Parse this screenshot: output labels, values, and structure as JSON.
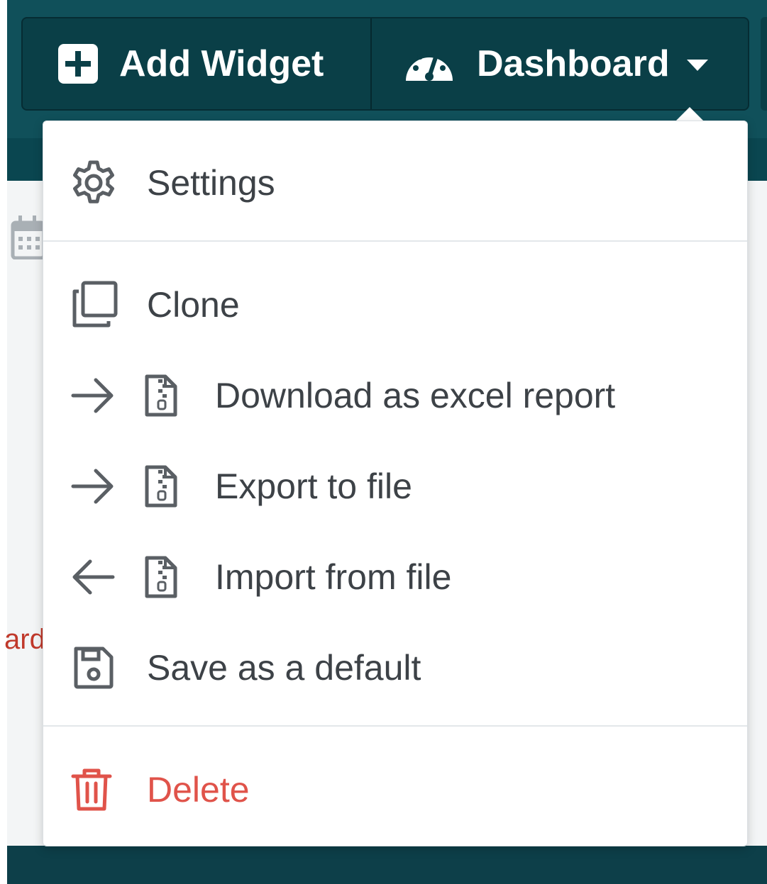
{
  "toolbar": {
    "add_widget_label": "Add Widget",
    "dashboard_label": "Dashboard"
  },
  "background": {
    "peek_text": "ard"
  },
  "menu": {
    "settings": "Settings",
    "clone": "Clone",
    "download_excel": "Download as excel report",
    "export_file": "Export to file",
    "import_file": "Import from file",
    "save_default": "Save as a default",
    "delete": "Delete"
  },
  "colors": {
    "header_bg": "#10505a",
    "toolbar_bg": "#0a3f47",
    "menu_text": "#3d4247",
    "danger": "#e0534a"
  },
  "icons": {
    "add": "plus-square-icon",
    "dashboard": "tachometer-icon",
    "caret": "caret-down-icon",
    "settings": "gear-icon",
    "clone": "clone-icon",
    "export": "arrow-right-icon",
    "import": "arrow-left-icon",
    "file": "file-zipper-icon",
    "save": "floppy-disk-icon",
    "delete": "trash-icon"
  }
}
